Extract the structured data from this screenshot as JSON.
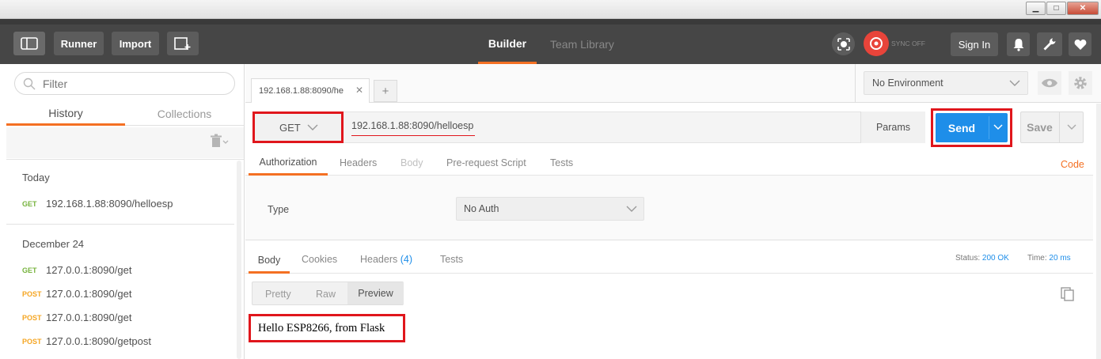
{
  "window": {
    "minimize": "▁",
    "maximize": "□",
    "close": "✕"
  },
  "header": {
    "runner": "Runner",
    "import": "Import",
    "tabs": [
      {
        "label": "Builder",
        "active": true
      },
      {
        "label": "Team Library",
        "active": false
      }
    ],
    "sync": "SYNC OFF",
    "sign_in": "Sign In",
    "accent": "#f47023"
  },
  "sidebar": {
    "filter_placeholder": "Filter",
    "tabs": [
      "History",
      "Collections"
    ],
    "groups": [
      {
        "label": "Today",
        "items": [
          {
            "method": "GET",
            "url": "192.168.1.88:8090/helloesp"
          }
        ]
      },
      {
        "label": "December 24",
        "items": [
          {
            "method": "GET",
            "url": "127.0.0.1:8090/get"
          },
          {
            "method": "POST",
            "url": "127.0.0.1:8090/get"
          },
          {
            "method": "POST",
            "url": "127.0.0.1:8090/get"
          },
          {
            "method": "POST",
            "url": "127.0.0.1:8090/getpost"
          }
        ]
      }
    ]
  },
  "request": {
    "tab_title": "192.168.1.88:8090/he",
    "environment": "No Environment",
    "method": "GET",
    "url": "192.168.1.88:8090/helloesp",
    "params": "Params",
    "send": "Send",
    "save": "Save",
    "tabs": [
      "Authorization",
      "Headers",
      "Body",
      "Pre-request Script",
      "Tests"
    ],
    "code": "Code",
    "auth_type_label": "Type",
    "auth_type_value": "No Auth"
  },
  "response": {
    "tabs": [
      "Body",
      "Cookies",
      "Headers",
      "Tests"
    ],
    "headers_count": "(4)",
    "status_label": "Status:",
    "status_value": "200 OK",
    "time_label": "Time:",
    "time_value": "20 ms",
    "views": [
      "Pretty",
      "Raw",
      "Preview"
    ],
    "body": "Hello ESP8266, from Flask"
  }
}
